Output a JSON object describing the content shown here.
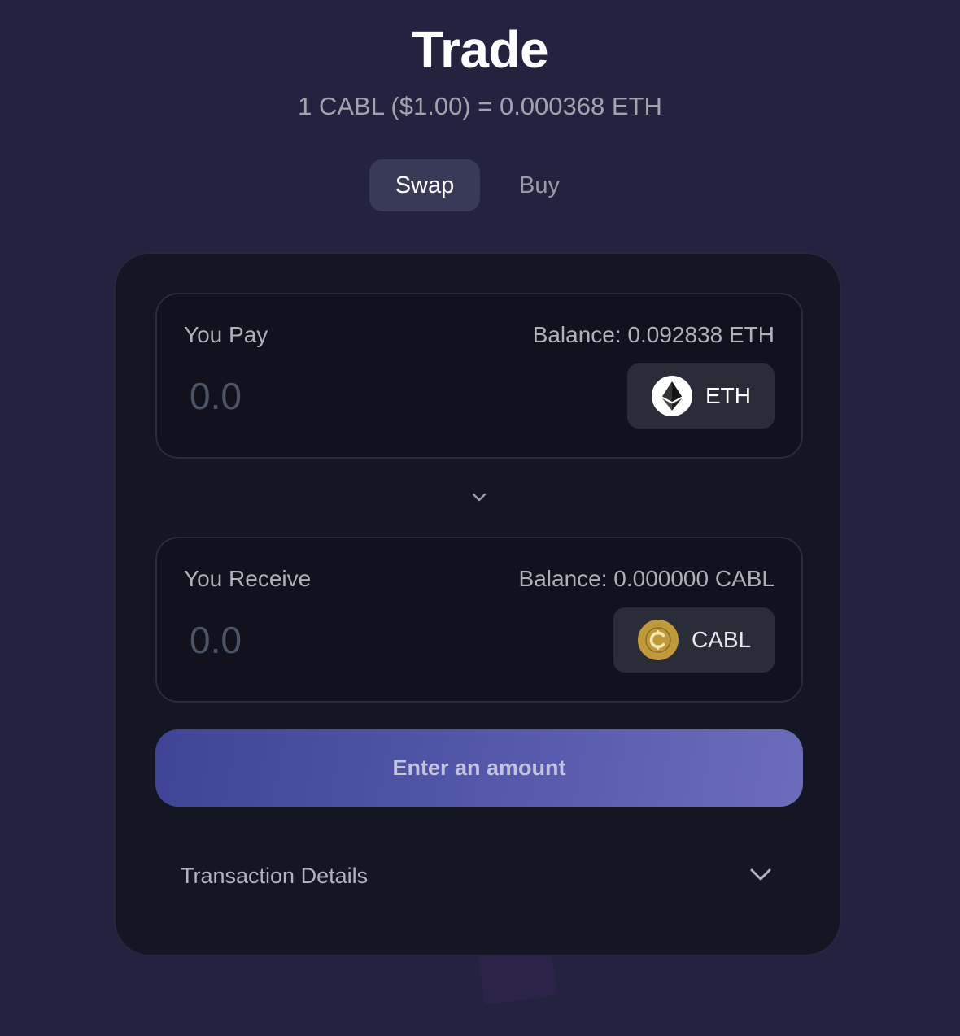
{
  "page": {
    "title": "Trade",
    "rate_text": "1 CABL ($1.00) = 0.000368 ETH"
  },
  "tabs": [
    {
      "label": "Swap",
      "active": true
    },
    {
      "label": "Buy",
      "active": false
    }
  ],
  "pay": {
    "label": "You Pay",
    "balance": "Balance: 0.092838 ETH",
    "amount_placeholder": "0.0",
    "token": {
      "symbol": "ETH",
      "icon": "ethereum-icon"
    }
  },
  "receive": {
    "label": "You Receive",
    "balance": "Balance: 0.000000 CABL",
    "amount_placeholder": "0.0",
    "token": {
      "symbol": "CABL",
      "icon": "cabl-coin-icon"
    }
  },
  "swap_direction_icon": "chevron-down-icon",
  "cta": {
    "label": "Enter an amount"
  },
  "details": {
    "label": "Transaction Details",
    "icon": "chevron-down-icon"
  },
  "colors": {
    "background": "#232340",
    "card": "#141624",
    "accent_start": "#3f4496",
    "accent_end": "#6b6cbb",
    "cabl_gold": "#c09a3a"
  }
}
